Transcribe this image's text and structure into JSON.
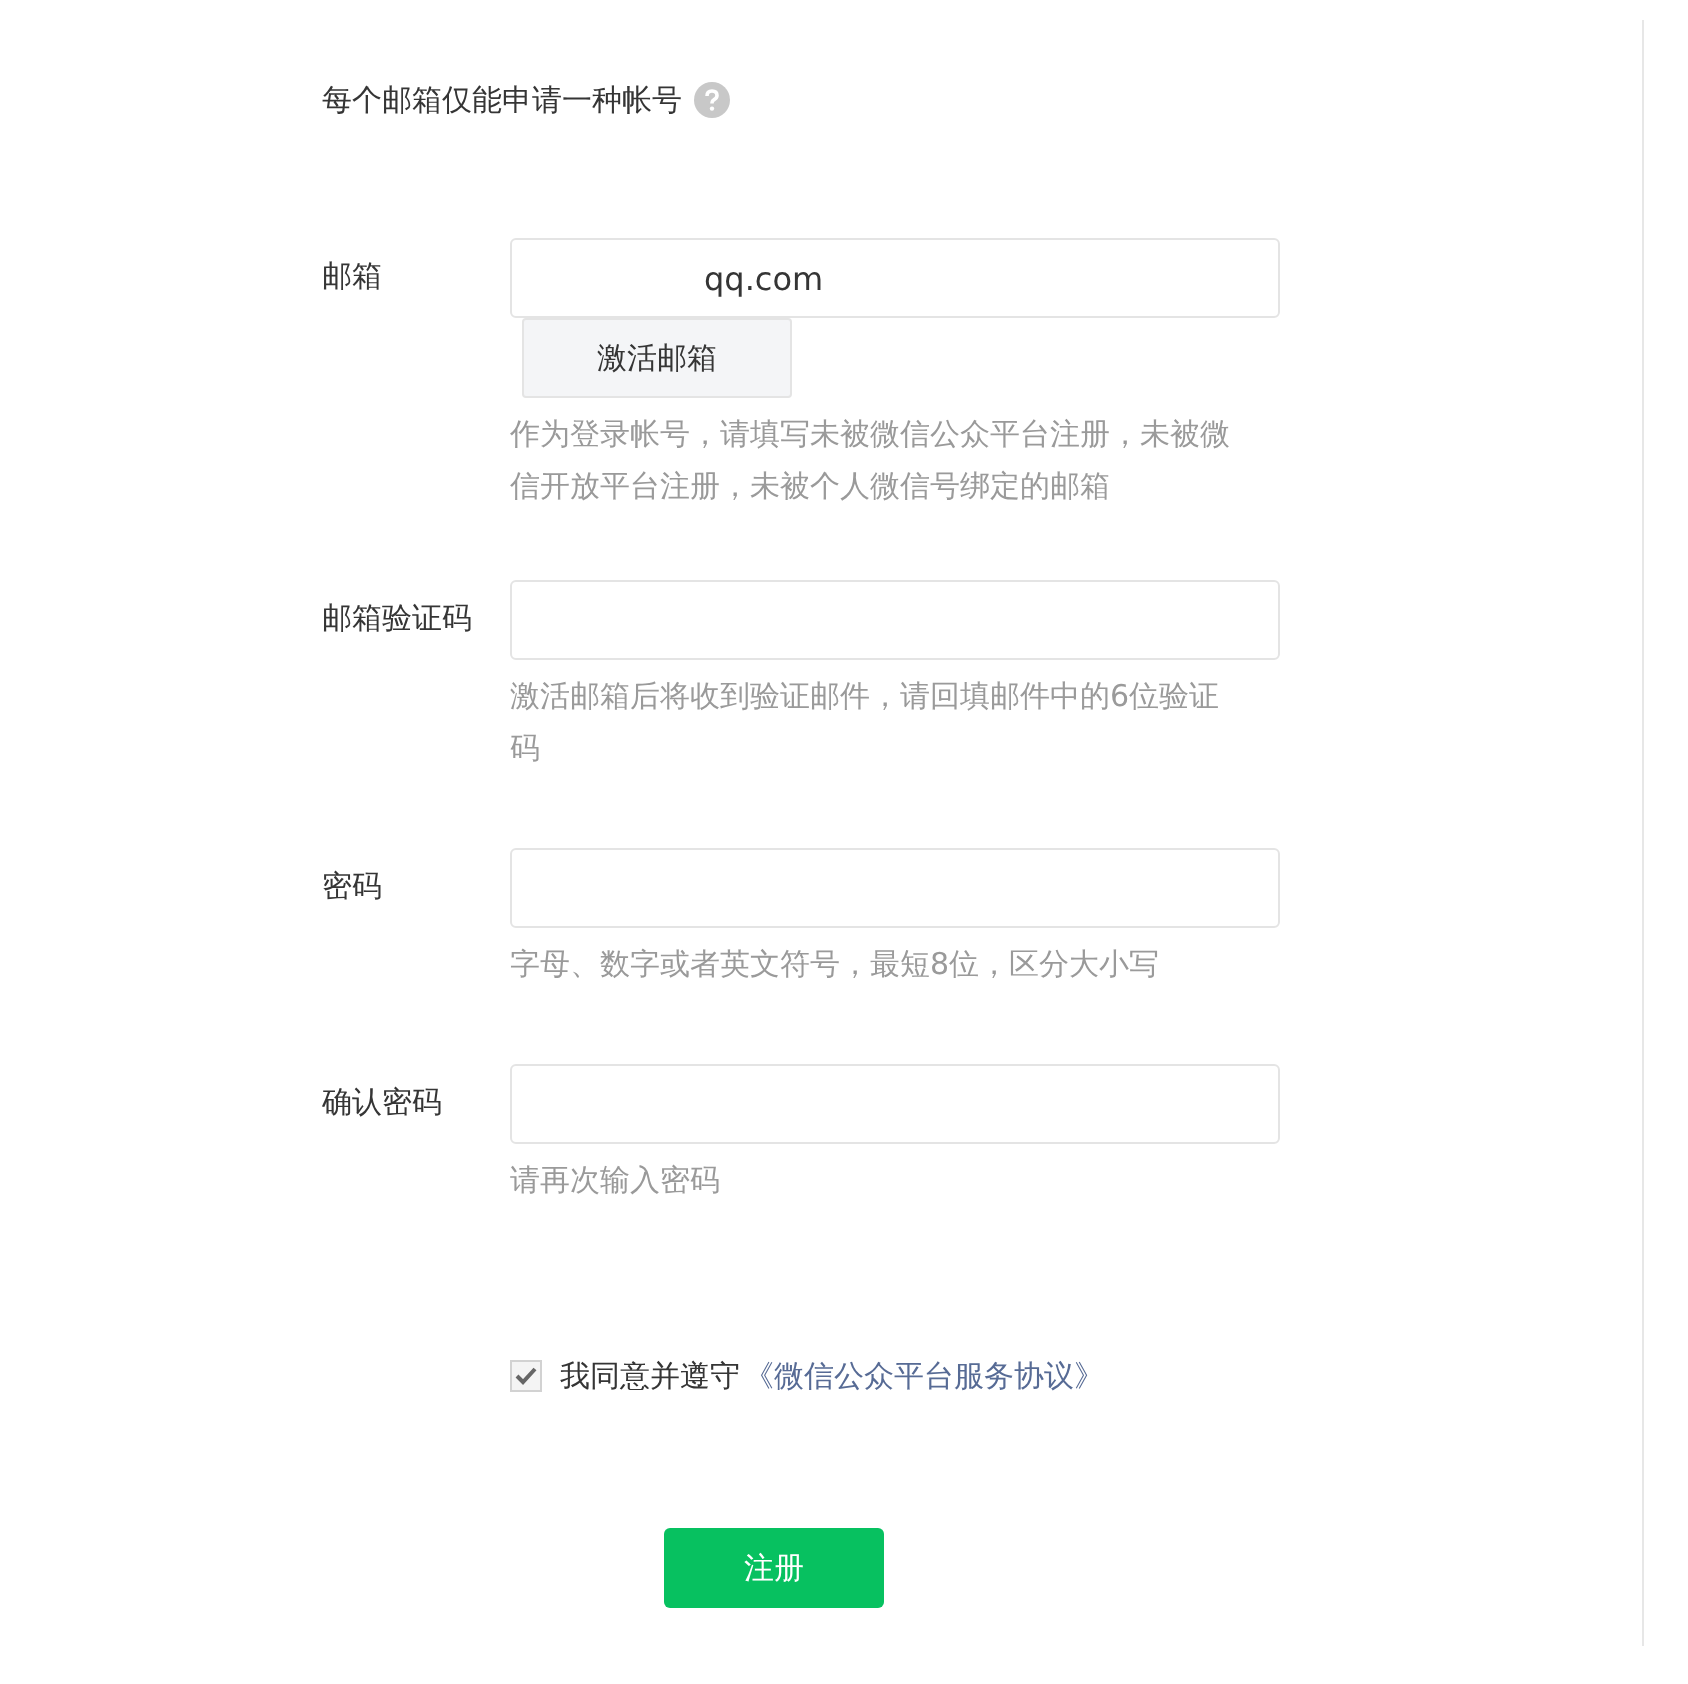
{
  "notice": {
    "text": "每个邮箱仅能申请一种帐号"
  },
  "fields": [
    {
      "label": "邮箱",
      "value": "qq.com",
      "action": "激活邮箱",
      "hint": "作为登录帐号，请填写未被微信公众平台注册，未被微信开放平台注册，未被个人微信号绑定的邮箱"
    },
    {
      "label": "邮箱验证码",
      "hint": "激活邮箱后将收到验证邮件，请回填邮件中的6位验证码"
    },
    {
      "label": "密码",
      "hint": "字母、数字或者英文符号，最短8位，区分大小写"
    },
    {
      "label": "确认密码",
      "hint": "请再次输入密码"
    }
  ],
  "agreement": {
    "checked": true,
    "text": "我同意并遵守",
    "link": "《微信公众平台服务协议》"
  },
  "submit": "注册"
}
